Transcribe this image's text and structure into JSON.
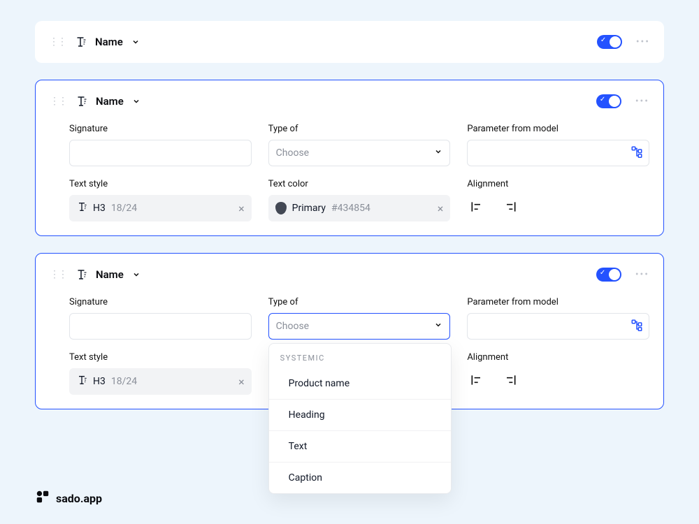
{
  "cards": [
    {
      "title": "Name"
    },
    {
      "title": "Name",
      "fields": {
        "signature_label": "Signature",
        "type_label": "Type of",
        "type_placeholder": "Choose",
        "param_label": "Parameter from model",
        "text_style_label": "Text style",
        "text_style_value": "H3",
        "text_style_dim": "18/24",
        "text_color_label": "Text color",
        "text_color_name": "Primary",
        "text_color_hex": "#434854",
        "alignment_label": "Alignment"
      }
    },
    {
      "title": "Name",
      "fields": {
        "signature_label": "Signature",
        "type_label": "Type of",
        "type_placeholder": "Choose",
        "param_label": "Parameter from model",
        "text_style_label": "Text style",
        "text_style_value": "H3",
        "text_style_dim": "18/24",
        "alignment_label": "Alignment"
      }
    }
  ],
  "dropdown": {
    "group_label": "Systemic",
    "items": [
      "Product name",
      "Heading",
      "Text",
      "Caption"
    ]
  },
  "brand": "sado.app"
}
